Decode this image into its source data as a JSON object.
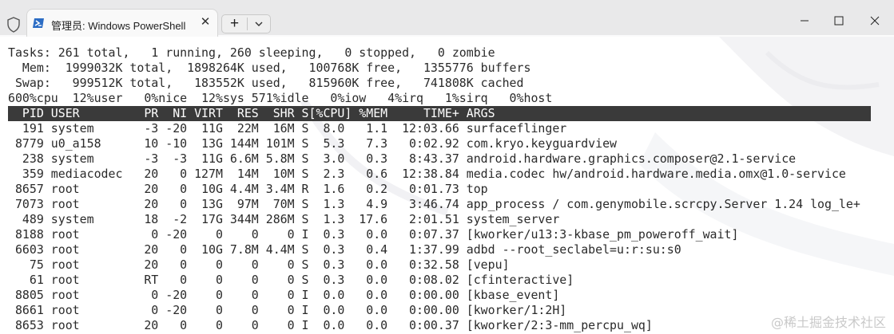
{
  "window": {
    "tab_title": "管理员: Windows PowerShell",
    "close_glyph": "✕",
    "new_tab_glyph": "+",
    "icons": [
      "shield-icon",
      "powershell-icon",
      "close-icon",
      "plus-icon",
      "chevron-down-icon",
      "minimize-icon",
      "maximize-icon",
      "window-close-icon"
    ]
  },
  "top": {
    "summary": [
      "Tasks: 261 total,   1 running, 260 sleeping,   0 stopped,   0 zombie",
      "  Mem:  1999032K total,  1898264K used,   100768K free,   1355776 buffers",
      " Swap:   999512K total,   183552K used,   815960K free,   741808K cached",
      "600%cpu  12%user   0%nice  12%sys 571%idle   0%iow   4%irq   1%sirq   0%host"
    ],
    "header": "  PID USER         PR  NI VIRT  RES  SHR S[%CPU] %MEM     TIME+ ARGS",
    "rows": [
      "  191 system       -3 -20  11G  22M  16M S  8.0   1.1  12:03.66 surfaceflinger",
      " 8779 u0_a158      10 -10  13G 144M 101M S  5.3   7.3   0:02.92 com.kryo.keyguardview",
      "  238 system       -3  -3  11G 6.6M 5.8M S  3.0   0.3   8:43.37 android.hardware.graphics.composer@2.1-service",
      "  359 mediacodec   20   0 127M  14M  10M S  2.3   0.6  12:38.84 media.codec hw/android.hardware.media.omx@1.0-service",
      " 8657 root         20   0  10G 4.4M 3.4M R  1.6   0.2   0:01.73 top",
      " 7073 root         20   0  13G  97M  70M S  1.3   4.9   3:46.74 app_process / com.genymobile.scrcpy.Server 1.24 log_le+",
      "  489 system       18  -2  17G 344M 286M S  1.3  17.6   2:01.51 system_server",
      " 8188 root          0 -20    0    0    0 I  0.3   0.0   0:07.37 [kworker/u13:3-kbase_pm_poweroff_wait]",
      " 6603 root         20   0  10G 7.8M 4.4M S  0.3   0.4   1:37.99 adbd --root_seclabel=u:r:su:s0",
      "   75 root         20   0    0    0    0 S  0.3   0.0   0:32.58 [vepu]",
      "   61 root         RT   0    0    0    0 S  0.3   0.0   0:08.02 [cfinteractive]",
      " 8805 root          0 -20    0    0    0 I  0.0   0.0   0:00.00 [kbase_event]",
      " 8661 root          0 -20    0    0    0 I  0.0   0.0   0:00.00 [kworker/1:2H]",
      " 8653 root         20   0    0    0    0 I  0.0   0.0   0:00.37 [kworker/2:3-mm_percpu_wq]"
    ]
  },
  "watermark": "@稀土掘金技术社区"
}
